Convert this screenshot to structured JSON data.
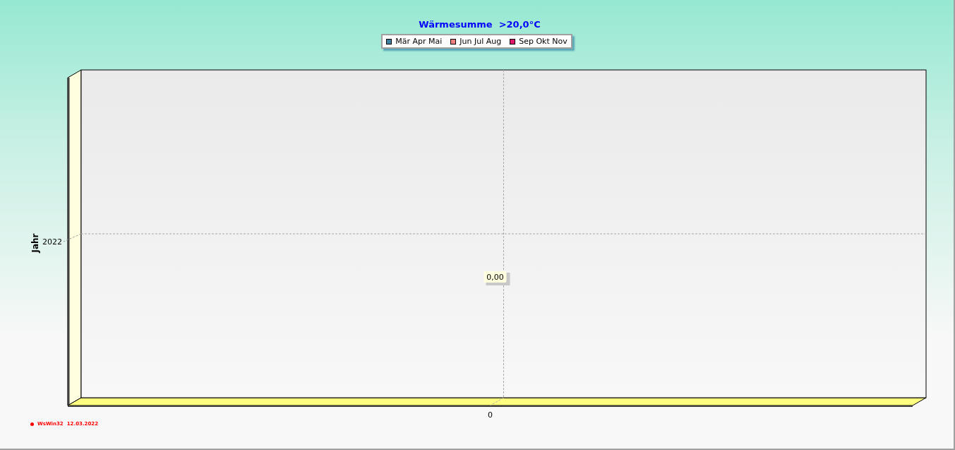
{
  "chart": {
    "title": "Wärmesumme  >20,0°C",
    "legend": [
      {
        "name": "Mär Apr Mai",
        "color": "#3f7f9f"
      },
      {
        "name": "Jun Jul Aug",
        "color": "#f08080"
      },
      {
        "name": "Sep Okt Nov",
        "color": "#e0186c"
      }
    ],
    "y_axis_title": "Jahr",
    "y_label": "2022",
    "x_label": "0",
    "value_label": "0,00"
  },
  "footer": {
    "program": "WsWin32",
    "date": "12.03.2022"
  }
}
